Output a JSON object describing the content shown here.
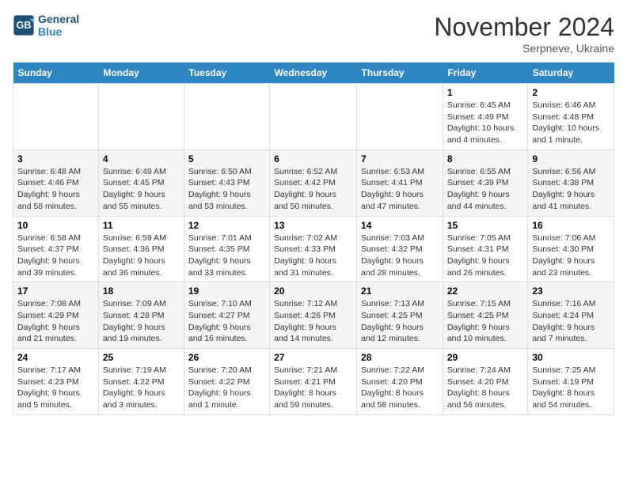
{
  "header": {
    "logo_text_general": "General",
    "logo_text_blue": "Blue",
    "month_title": "November 2024",
    "subtitle": "Serpneve, Ukraine"
  },
  "days_of_week": [
    "Sunday",
    "Monday",
    "Tuesday",
    "Wednesday",
    "Thursday",
    "Friday",
    "Saturday"
  ],
  "weeks": [
    [
      {
        "num": "",
        "info": ""
      },
      {
        "num": "",
        "info": ""
      },
      {
        "num": "",
        "info": ""
      },
      {
        "num": "",
        "info": ""
      },
      {
        "num": "",
        "info": ""
      },
      {
        "num": "1",
        "info": "Sunrise: 6:45 AM\nSunset: 4:49 PM\nDaylight: 10 hours and 4 minutes."
      },
      {
        "num": "2",
        "info": "Sunrise: 6:46 AM\nSunset: 4:48 PM\nDaylight: 10 hours and 1 minute."
      }
    ],
    [
      {
        "num": "3",
        "info": "Sunrise: 6:48 AM\nSunset: 4:46 PM\nDaylight: 9 hours and 58 minutes."
      },
      {
        "num": "4",
        "info": "Sunrise: 6:49 AM\nSunset: 4:45 PM\nDaylight: 9 hours and 55 minutes."
      },
      {
        "num": "5",
        "info": "Sunrise: 6:50 AM\nSunset: 4:43 PM\nDaylight: 9 hours and 53 minutes."
      },
      {
        "num": "6",
        "info": "Sunrise: 6:52 AM\nSunset: 4:42 PM\nDaylight: 9 hours and 50 minutes."
      },
      {
        "num": "7",
        "info": "Sunrise: 6:53 AM\nSunset: 4:41 PM\nDaylight: 9 hours and 47 minutes."
      },
      {
        "num": "8",
        "info": "Sunrise: 6:55 AM\nSunset: 4:39 PM\nDaylight: 9 hours and 44 minutes."
      },
      {
        "num": "9",
        "info": "Sunrise: 6:56 AM\nSunset: 4:38 PM\nDaylight: 9 hours and 41 minutes."
      }
    ],
    [
      {
        "num": "10",
        "info": "Sunrise: 6:58 AM\nSunset: 4:37 PM\nDaylight: 9 hours and 39 minutes."
      },
      {
        "num": "11",
        "info": "Sunrise: 6:59 AM\nSunset: 4:36 PM\nDaylight: 9 hours and 36 minutes."
      },
      {
        "num": "12",
        "info": "Sunrise: 7:01 AM\nSunset: 4:35 PM\nDaylight: 9 hours and 33 minutes."
      },
      {
        "num": "13",
        "info": "Sunrise: 7:02 AM\nSunset: 4:33 PM\nDaylight: 9 hours and 31 minutes."
      },
      {
        "num": "14",
        "info": "Sunrise: 7:03 AM\nSunset: 4:32 PM\nDaylight: 9 hours and 28 minutes."
      },
      {
        "num": "15",
        "info": "Sunrise: 7:05 AM\nSunset: 4:31 PM\nDaylight: 9 hours and 26 minutes."
      },
      {
        "num": "16",
        "info": "Sunrise: 7:06 AM\nSunset: 4:30 PM\nDaylight: 9 hours and 23 minutes."
      }
    ],
    [
      {
        "num": "17",
        "info": "Sunrise: 7:08 AM\nSunset: 4:29 PM\nDaylight: 9 hours and 21 minutes."
      },
      {
        "num": "18",
        "info": "Sunrise: 7:09 AM\nSunset: 4:28 PM\nDaylight: 9 hours and 19 minutes."
      },
      {
        "num": "19",
        "info": "Sunrise: 7:10 AM\nSunset: 4:27 PM\nDaylight: 9 hours and 16 minutes."
      },
      {
        "num": "20",
        "info": "Sunrise: 7:12 AM\nSunset: 4:26 PM\nDaylight: 9 hours and 14 minutes."
      },
      {
        "num": "21",
        "info": "Sunrise: 7:13 AM\nSunset: 4:25 PM\nDaylight: 9 hours and 12 minutes."
      },
      {
        "num": "22",
        "info": "Sunrise: 7:15 AM\nSunset: 4:25 PM\nDaylight: 9 hours and 10 minutes."
      },
      {
        "num": "23",
        "info": "Sunrise: 7:16 AM\nSunset: 4:24 PM\nDaylight: 9 hours and 7 minutes."
      }
    ],
    [
      {
        "num": "24",
        "info": "Sunrise: 7:17 AM\nSunset: 4:23 PM\nDaylight: 9 hours and 5 minutes."
      },
      {
        "num": "25",
        "info": "Sunrise: 7:19 AM\nSunset: 4:22 PM\nDaylight: 9 hours and 3 minutes."
      },
      {
        "num": "26",
        "info": "Sunrise: 7:20 AM\nSunset: 4:22 PM\nDaylight: 9 hours and 1 minute."
      },
      {
        "num": "27",
        "info": "Sunrise: 7:21 AM\nSunset: 4:21 PM\nDaylight: 8 hours and 59 minutes."
      },
      {
        "num": "28",
        "info": "Sunrise: 7:22 AM\nSunset: 4:20 PM\nDaylight: 8 hours and 58 minutes."
      },
      {
        "num": "29",
        "info": "Sunrise: 7:24 AM\nSunset: 4:20 PM\nDaylight: 8 hours and 56 minutes."
      },
      {
        "num": "30",
        "info": "Sunrise: 7:25 AM\nSunset: 4:19 PM\nDaylight: 8 hours and 54 minutes."
      }
    ]
  ]
}
